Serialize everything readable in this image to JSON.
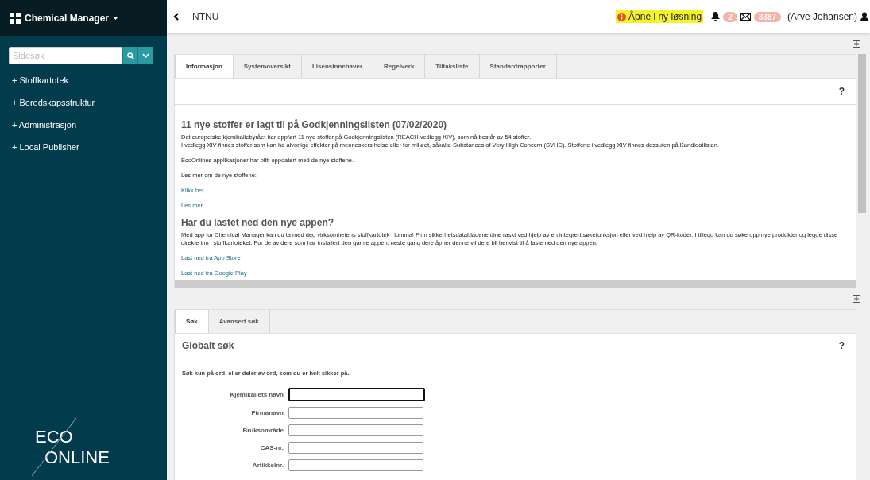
{
  "app": {
    "title": "Chemical Manager"
  },
  "sidebar": {
    "search": {
      "placeholder": "Sidesøk"
    },
    "items": [
      {
        "label": "+ Stoffkartotek"
      },
      {
        "label": "+ Beredskapsstruktur"
      },
      {
        "label": "+ Administrasjon"
      },
      {
        "label": "+ Local Publisher"
      }
    ],
    "logo": {
      "line_1": "ECO",
      "line_2": "ONLINE"
    }
  },
  "header": {
    "breadcrumb": "NTNU",
    "notice": "Åpne i ny løsning",
    "notifications": "2",
    "messages": "3387",
    "user": "(Arve Johansen)"
  },
  "info_panel": {
    "tabs": [
      {
        "label": "Informasjon",
        "selected": true
      },
      {
        "label": "Systemoversikt",
        "selected": false
      },
      {
        "label": "Lisensinnehaver",
        "selected": false
      },
      {
        "label": "Regelverk",
        "selected": false
      },
      {
        "label": "Tiltaksliste",
        "selected": false
      },
      {
        "label": "Standardrapporter",
        "selected": false
      }
    ],
    "help": "?",
    "sections": [
      {
        "heading": "11 nye stoffer er lagt til på Godkjenningslisten (07/02/2020)",
        "paragraphs": [
          {
            "kind": "text",
            "lines": [
              "Det europeiske kjemikaliebyrået har oppført 11 nye stoffer på Godkjenningslisten (REACH vedlegg XIV), som nå består av 54 stoffer.",
              "I vedlegg XIV finnes stoffer som kan ha alvorlige effekter på menneskers helse eller for miljøet, såkalte Substances of Very High Concern (SVHC). Stoffene i vedlegg XIV finnes dessuten på Kandidatlisten."
            ]
          },
          {
            "kind": "text",
            "lines": [
              "EcoOnlines applikasjoner har blitt oppdatert med de nye stoffene."
            ]
          },
          {
            "kind": "text",
            "lines": [
              "Les mer om de nye stoffene:"
            ]
          },
          {
            "kind": "link",
            "lines": [
              "Klikk her"
            ]
          },
          {
            "kind": "link",
            "lines": [
              "Les mer"
            ]
          }
        ]
      },
      {
        "heading": "Har du lastet ned den nye appen?",
        "paragraphs": [
          {
            "kind": "text",
            "lines": [
              "Med app for Chemical Manager kan du ta med deg virksomhetens stoffkartotek i lomma! Finn sikkerhetsdatabladene dine raskt ved hjelp av en integrert søkefunksjon eller ved hjelp av QR-koder. I tillegg kan du søke opp nye produkter og legge disse direkte inn i stoffkartoteket. For de av dere som har installert den gamle appen: neste gang dere åpner denne vil dere bli henvist til å laste ned den nye appen."
            ]
          },
          {
            "kind": "link",
            "lines": [
              "Last ned fra App Store"
            ]
          },
          {
            "kind": "link",
            "lines": [
              "Last ned fra Google Play"
            ]
          }
        ]
      }
    ]
  },
  "search_panel": {
    "tabs": [
      {
        "label": "Søk",
        "selected": true
      },
      {
        "label": "Avansert søk",
        "selected": false
      }
    ],
    "title": "Globalt søk",
    "help": "?",
    "hint": "Søk kun på ord, eller deler av ord, som du er helt sikker på.",
    "fields": [
      {
        "label": "Kjemikaliets navn",
        "focused": true
      },
      {
        "label": "Firmanavn",
        "focused": false
      },
      {
        "label": "Bruksområde",
        "focused": false
      },
      {
        "label": "CAS-nr.",
        "focused": false
      },
      {
        "label": "Artikkelnr.",
        "focused": false
      }
    ]
  }
}
